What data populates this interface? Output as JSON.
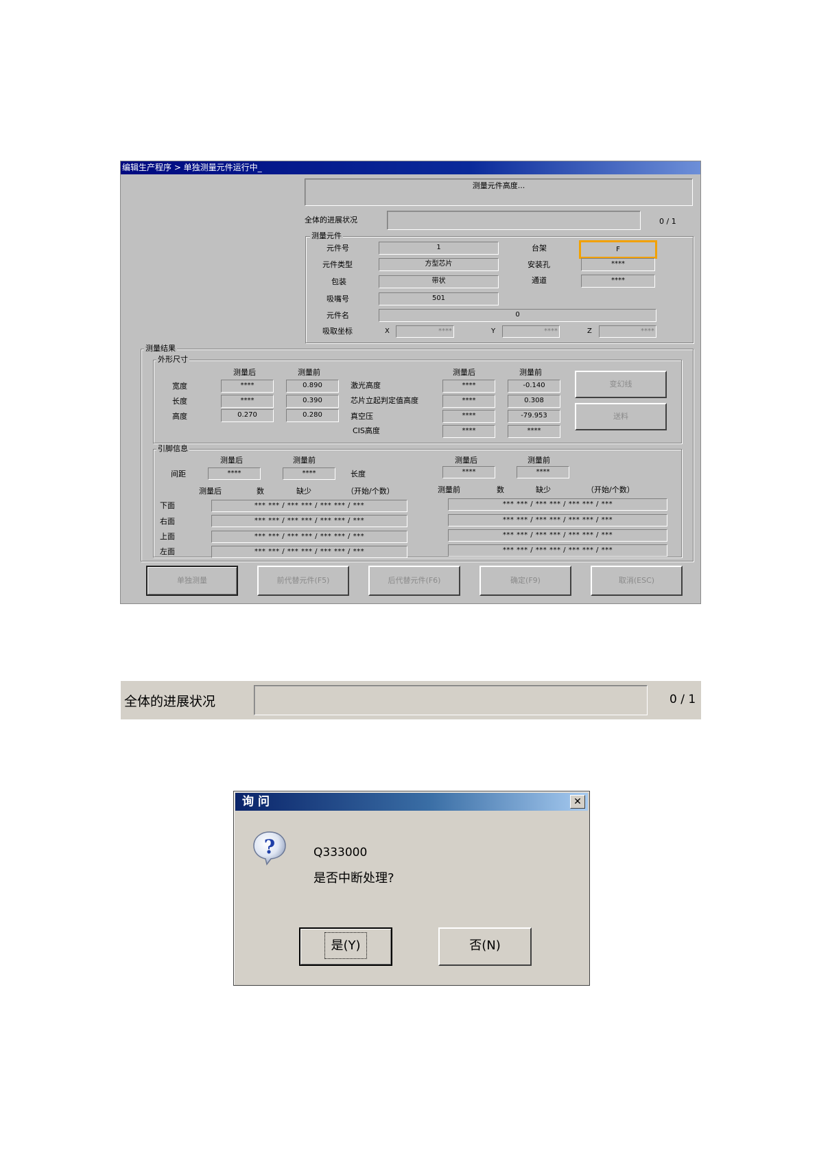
{
  "window": {
    "title": "编辑生产程序 > 单独测量元件运行中_",
    "status_message": "测量元件高度...",
    "overall_progress": {
      "label": "全体的进展状况",
      "count": "0 / 1",
      "value": 0
    }
  },
  "component": {
    "group_title": "测量元件",
    "number_label": "元件号",
    "number": "1",
    "type_label": "元件类型",
    "type": "方型芯片",
    "package_label": "包装",
    "package": "带状",
    "nozzle_label": "吸嘴号",
    "nozzle": "501",
    "name_label": "元件名",
    "name": "0",
    "pick_label": "吸取坐标",
    "x_label": "X",
    "x": "****",
    "y_label": "Y",
    "y": "****",
    "z_label": "Z",
    "z": "****",
    "rack_label": "台架",
    "rack": "F",
    "hole_label": "安装孔",
    "hole": "****",
    "lane_label": "通道",
    "lane": "****"
  },
  "results": {
    "group_title": "测量结果",
    "outline": {
      "group_title": "外形尺寸",
      "after_label": "测量后",
      "before_label": "测量前",
      "width_label": "宽度",
      "width_after": "****",
      "width_before": "0.890",
      "length_label": "长度",
      "length_after": "****",
      "length_before": "0.390",
      "height_label": "高度",
      "height_after": "0.270",
      "height_before": "0.280",
      "laser_label": "激光高度",
      "laser_after": "****",
      "laser_before": "-0.140",
      "stand_label": "芯片立起判定值高度",
      "stand_after": "****",
      "stand_before": "0.308",
      "vacuum_label": "真空压",
      "vacuum_after": "****",
      "vacuum_before": "-79.953",
      "cis_label": "CIS高度",
      "cis_after": "****",
      "cis_before": "****",
      "change_button": "变幻线",
      "feed_button": "送料"
    },
    "pins": {
      "group_title": "引脚信息",
      "after_label": "测量后",
      "before_label": "测量前",
      "pitch_label": "间距",
      "pitch_after": "****",
      "pitch_before": "****",
      "length_label": "长度",
      "length_after": "****",
      "length_before": "****",
      "cols_after": [
        "测量后",
        "数",
        "缺少",
        "（开始/个数）"
      ],
      "cols_before": [
        "测量前",
        "数",
        "缺少",
        "（开始/个数）"
      ],
      "sides": [
        {
          "label": "下面",
          "after": "*** *** / *** *** / *** *** / ***",
          "before": "*** *** / *** *** / *** *** / ***"
        },
        {
          "label": "右面",
          "after": "*** *** / *** *** / *** *** / ***",
          "before": "*** *** / *** *** / *** *** / ***"
        },
        {
          "label": "上面",
          "after": "*** *** / *** *** / *** *** / ***",
          "before": "*** *** / *** *** / *** *** / ***"
        },
        {
          "label": "左面",
          "after": "*** *** / *** *** / *** *** / ***",
          "before": "*** *** / *** *** / *** *** / ***"
        }
      ]
    }
  },
  "buttons": {
    "single": "单独测量",
    "prev": "前代替元件(F5)",
    "next": "后代替元件(F6)",
    "ok": "确定(F9)",
    "cancel": "取消(ESC)"
  },
  "zoom": {
    "label": "全体的进展状况",
    "count": "0 / 1"
  },
  "dialog": {
    "title": "询问",
    "code": "Q333000",
    "message": "是否中断处理?",
    "yes": "是(Y)",
    "no": "否(N)",
    "close": "✕"
  },
  "colors": {
    "highlight": "#f2a100",
    "title_bar": "#0a246a"
  }
}
